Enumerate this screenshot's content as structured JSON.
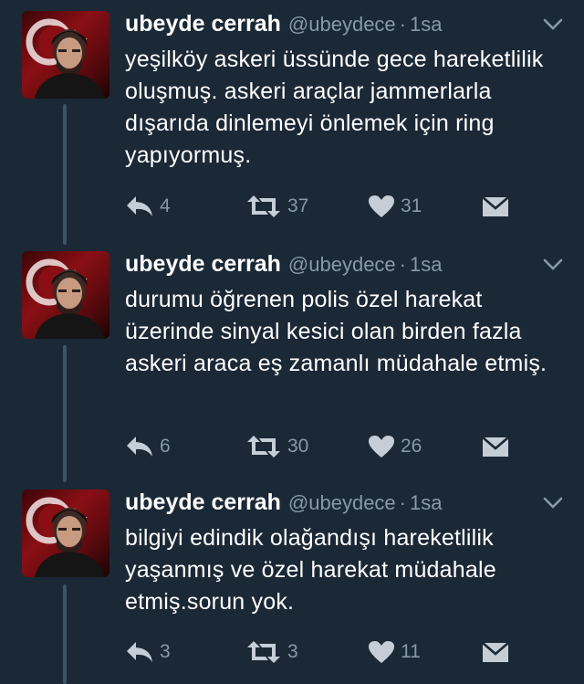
{
  "tweets": [
    {
      "name": "ubeyde cerrah",
      "handle": "@ubeydece",
      "separator": "·",
      "time": "1sa",
      "text": "yeşilköy askeri üssünde gece hareketlilik oluşmuş. askeri araçlar jammerlarla dışarıda dinlemeyi önlemek için ring yapıyormuş.",
      "replies": "4",
      "retweets": "37",
      "likes": "31"
    },
    {
      "name": "ubeyde cerrah",
      "handle": "@ubeydece",
      "separator": "·",
      "time": "1sa",
      "text": "durumu öğrenen polis özel harekat üzerinde sinyal kesici olan birden fazla askeri araca eş zamanlı müdahale etmiş.",
      "replies": "6",
      "retweets": "30",
      "likes": "26"
    },
    {
      "name": "ubeyde cerrah",
      "handle": "@ubeydece",
      "separator": "·",
      "time": "1sa",
      "text": "bilgiyi edindik olağandışı hareketlilik yaşanmış ve özel harekat müdahale etmiş.sorun yok.",
      "replies": "3",
      "retweets": "3",
      "likes": "11"
    }
  ],
  "icons": {
    "reply": "reply-icon",
    "retweet": "retweet-icon",
    "like": "heart-icon",
    "dm": "envelope-icon",
    "menu": "chevron-down-icon"
  },
  "colors": {
    "background": "#1b2836",
    "muted": "#8899a6",
    "icon": "#c5ced6",
    "thread_line": "#3d5466"
  }
}
